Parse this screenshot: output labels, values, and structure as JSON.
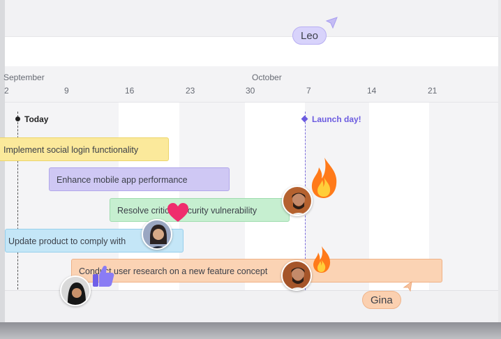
{
  "cursors": {
    "leo": {
      "label": "Leo"
    },
    "gina": {
      "label": "Gina"
    }
  },
  "timeline": {
    "months": {
      "september": "September",
      "october": "October"
    },
    "days": [
      "2",
      "9",
      "16",
      "23",
      "30",
      "7",
      "14",
      "21"
    ]
  },
  "markers": {
    "today": "Today",
    "launch": "Launch day!"
  },
  "tasks": [
    {
      "label": "Implement social login functionality",
      "color": "#fbe99b"
    },
    {
      "label": "Enhance mobile app performance",
      "color": "#cfc8f4"
    },
    {
      "label": "Resolve critical security vulnerability",
      "color": "#c6efd0"
    },
    {
      "label": "Update product to comply with",
      "color": "#c4e6f7"
    },
    {
      "label": "Conduct user research on a new feature concept",
      "color": "#fbd3b4"
    }
  ],
  "reactions": {
    "fire": "fire-icon",
    "heart": "heart-icon",
    "thumbs_up": "thumbs-up-icon"
  },
  "colors": {
    "accent": "#6b5be0",
    "today": "#222222"
  }
}
